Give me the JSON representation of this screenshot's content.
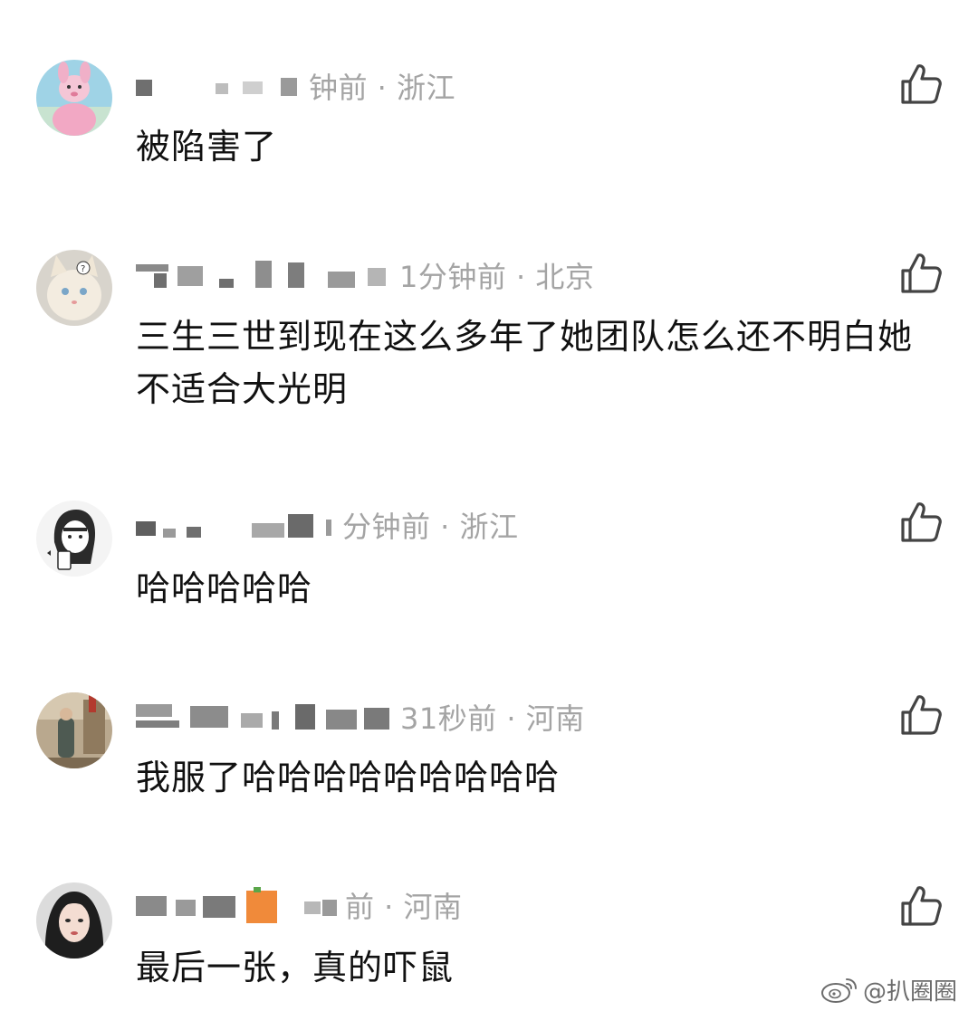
{
  "comments": [
    {
      "meta": "钟前 · 浙江",
      "text": "被陷害了",
      "like_icon": "thumbs-up-icon",
      "avatar": "pink-plush-avatar"
    },
    {
      "meta": "1分钟前 · 北京",
      "text": "三生三世到现在这么多年了她团队怎么还不明白她不适合大光明",
      "like_icon": "thumbs-up-icon",
      "avatar": "white-cat-avatar"
    },
    {
      "meta": "分钟前 · 浙江",
      "text": "哈哈哈哈哈",
      "like_icon": "thumbs-up-icon",
      "avatar": "sketch-girl-avatar"
    },
    {
      "meta": "31秒前 · 河南",
      "text": "我服了哈哈哈哈哈哈哈哈哈",
      "like_icon": "thumbs-up-icon",
      "avatar": "street-photo-avatar"
    },
    {
      "meta": "前 · 河南",
      "text": "最后一张，真的吓鼠",
      "like_icon": "thumbs-up-icon",
      "avatar": "girl-portrait-avatar"
    }
  ],
  "watermark": {
    "text": "@扒圈圈",
    "icon": "weibo-logo-icon"
  },
  "colors": {
    "meta_gray": "#a4a4a4",
    "text": "#111111",
    "icon": "#444444"
  }
}
